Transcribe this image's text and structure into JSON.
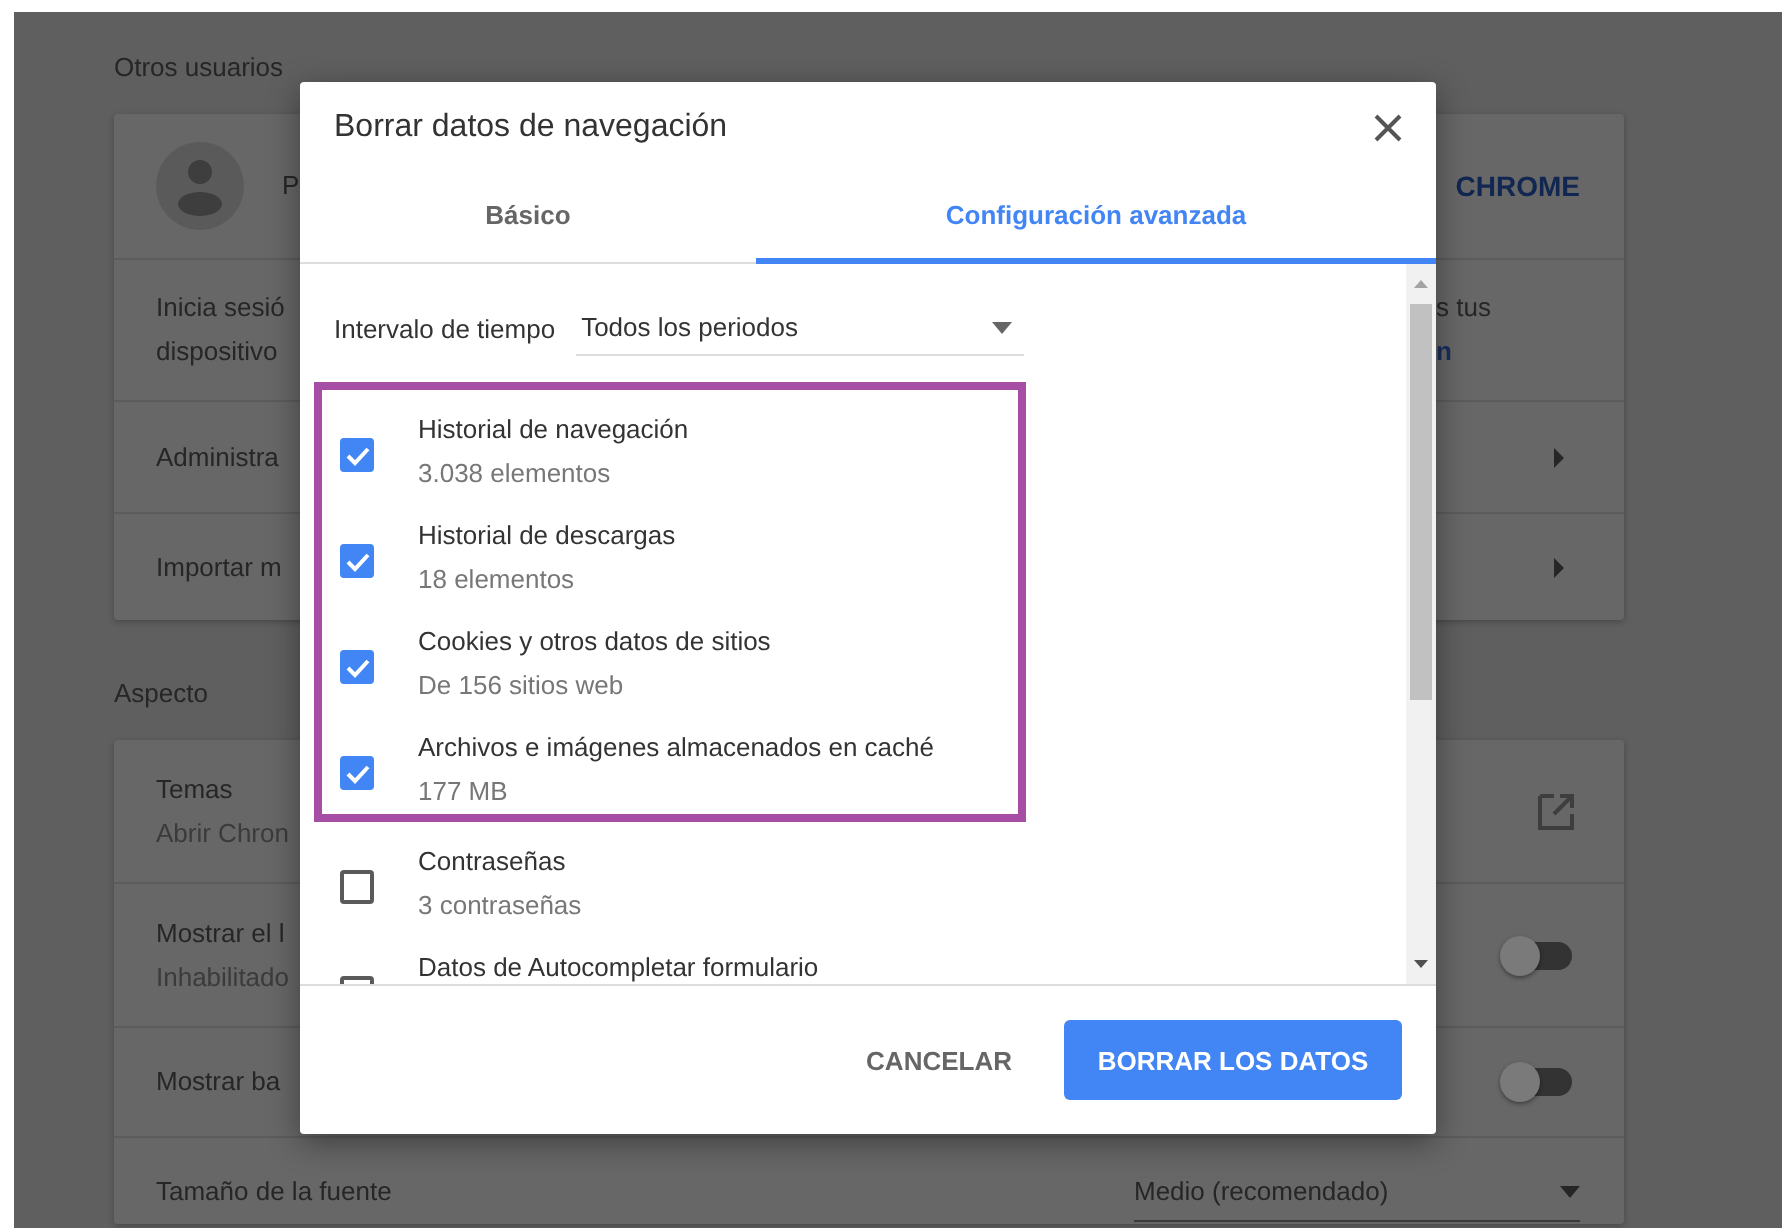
{
  "background": {
    "sections": [
      {
        "title": "Otros usuarios",
        "rows": [
          {
            "kind": "profile",
            "label": "P",
            "action": "CHROME"
          },
          {
            "kind": "text",
            "lines": [
              "Inicia sesió",
              "dispositivo"
            ],
            "right_lines": [
              {
                "text": "s tus",
                "link": false
              },
              {
                "text": "n",
                "link": true
              }
            ]
          },
          {
            "kind": "nav",
            "label": "Administra"
          },
          {
            "kind": "nav",
            "label": "Importar m"
          }
        ]
      },
      {
        "title": "Aspecto",
        "rows": [
          {
            "kind": "link",
            "label": "Temas",
            "sublabel": "Abrir Chron"
          },
          {
            "kind": "toggle",
            "label": "Mostrar el l",
            "sublabel": "Inhabilitado",
            "on": false
          },
          {
            "kind": "toggle",
            "label": "Mostrar ba",
            "on": false
          },
          {
            "kind": "select",
            "label": "Tamaño de la fuente",
            "value": "Medio (recomendado)"
          }
        ]
      }
    ]
  },
  "dialog": {
    "title": "Borrar datos de navegación",
    "tabs": [
      {
        "label": "Básico",
        "selected": false
      },
      {
        "label": "Configuración avanzada",
        "selected": true
      }
    ],
    "time_range": {
      "label": "Intervalo de tiempo",
      "value": "Todos los periodos"
    },
    "items": [
      {
        "title": "Historial de navegación",
        "subtitle": "3.038 elementos",
        "checked": true,
        "highlighted": true
      },
      {
        "title": "Historial de descargas",
        "subtitle": "18 elementos",
        "checked": true,
        "highlighted": true
      },
      {
        "title": "Cookies y otros datos de sitios",
        "subtitle": "De 156 sitios web",
        "checked": true,
        "highlighted": true
      },
      {
        "title": "Archivos e imágenes almacenados en caché",
        "subtitle": "177 MB",
        "checked": true,
        "highlighted": true
      },
      {
        "title": "Contraseñas",
        "subtitle": "3 contraseñas",
        "checked": false,
        "highlighted": false
      },
      {
        "title": "Datos de Autocompletar formulario",
        "checked": false,
        "highlighted": false
      }
    ],
    "buttons": [
      {
        "label": "CANCELAR",
        "kind": "text"
      },
      {
        "label": "BORRAR LOS DATOS",
        "kind": "primary"
      }
    ]
  }
}
